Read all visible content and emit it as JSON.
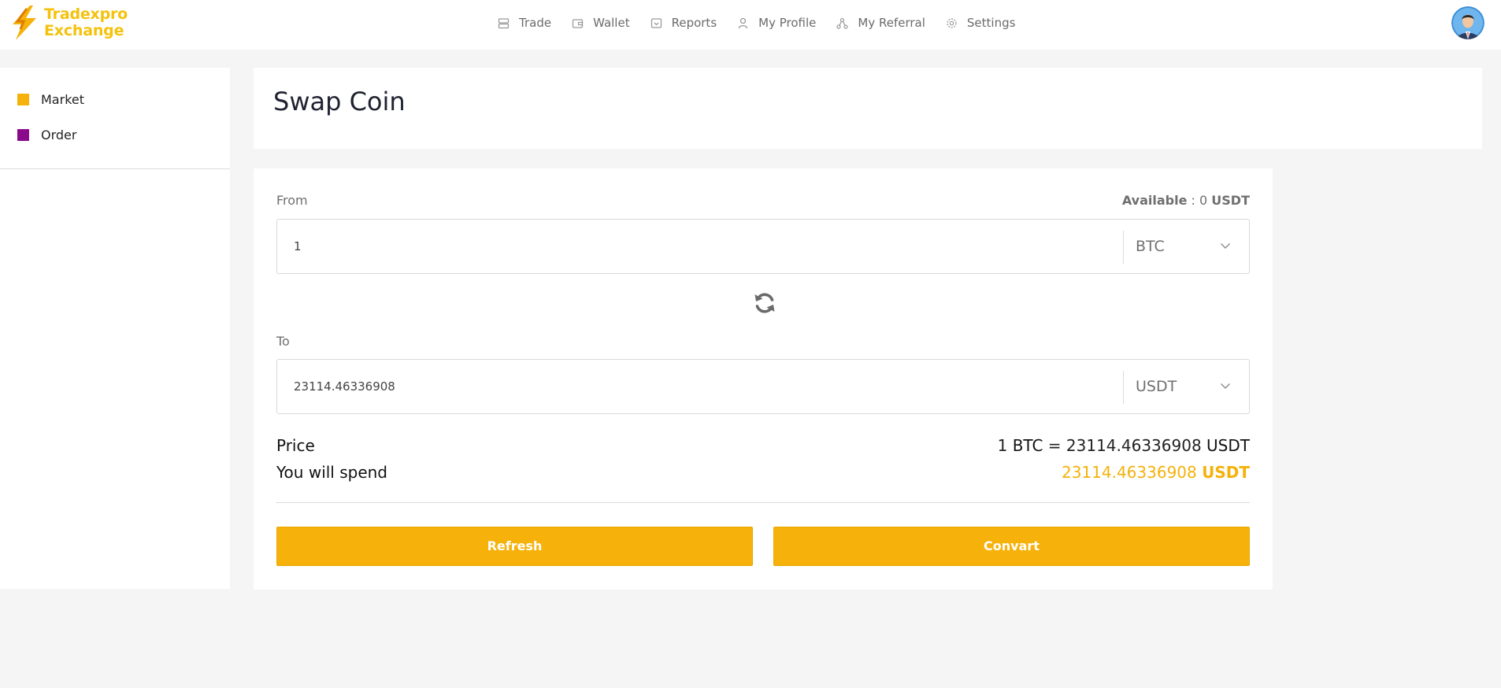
{
  "brand": {
    "line1": "Tradexpro",
    "line2": "Exchange"
  },
  "nav": [
    {
      "label": "Trade",
      "icon": "trade-icon"
    },
    {
      "label": "Wallet",
      "icon": "wallet-icon"
    },
    {
      "label": "Reports",
      "icon": "reports-icon"
    },
    {
      "label": "My Profile",
      "icon": "profile-icon"
    },
    {
      "label": "My Referral",
      "icon": "referral-icon"
    },
    {
      "label": "Settings",
      "icon": "settings-icon"
    }
  ],
  "sidebar": {
    "items": [
      {
        "label": "Market",
        "color": "#f6b20a"
      },
      {
        "label": "Order",
        "color": "#8b0a8b"
      }
    ]
  },
  "page": {
    "title": "Swap Coin"
  },
  "form": {
    "from_label": "From",
    "available_label": "Available",
    "available_sep": ":",
    "available_amount": "0",
    "available_currency": "USDT",
    "from_value": "1",
    "from_currency": "BTC",
    "to_label": "To",
    "to_value": "23114.46336908",
    "to_currency": "USDT",
    "price_label": "Price",
    "price_from_amount": "1",
    "price_from_currency": "BTC",
    "price_equals": "=",
    "price_to_amount": "23114.46336908",
    "price_to_currency": "USDT",
    "spend_label": "You will spend",
    "spend_amount": "23114.46336908",
    "spend_currency": "USDT",
    "refresh_label": "Refresh",
    "convert_label": "Convart"
  },
  "colors": {
    "accent": "#f6b20a",
    "brand_yellow": "#f4c20d",
    "order_purple": "#8b0a8b"
  }
}
